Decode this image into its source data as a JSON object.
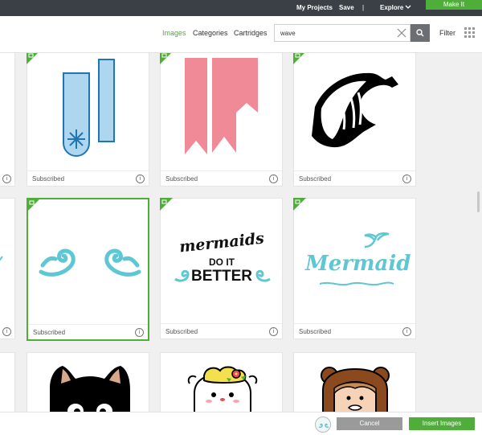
{
  "topbar": {
    "my_projects": "My Projects",
    "save": "Save",
    "separator": "|",
    "explore": "Explore",
    "make_it": "Make It"
  },
  "toolbar": {
    "images": "Images",
    "categories": "Categories",
    "cartridges": "Cartridges",
    "search_value": "wave",
    "filter": "Filter"
  },
  "cards": [
    {
      "label": "Subscribed",
      "info": "i",
      "title": ""
    },
    {
      "label": "Subscribed",
      "info": "i",
      "title": ""
    },
    {
      "label": "Subscribed",
      "info": "i",
      "title": ""
    },
    {
      "label": "Subscribed",
      "info": "i",
      "title": ""
    },
    {
      "label": "Subscribed",
      "info": "i",
      "line1": "mermaids",
      "line2": "DO IT",
      "line3": "BETTER"
    },
    {
      "label": "Subscribed",
      "info": "i",
      "title": "Mermaid"
    }
  ],
  "bottom": {
    "cancel": "Cancel",
    "insert": "Insert Images"
  },
  "colors": {
    "accent": "#4fae3a",
    "topbar": "#3b4046",
    "aqua": "#5ec7d4",
    "pink": "#f08a96",
    "iceblue": "#aed6ee"
  }
}
